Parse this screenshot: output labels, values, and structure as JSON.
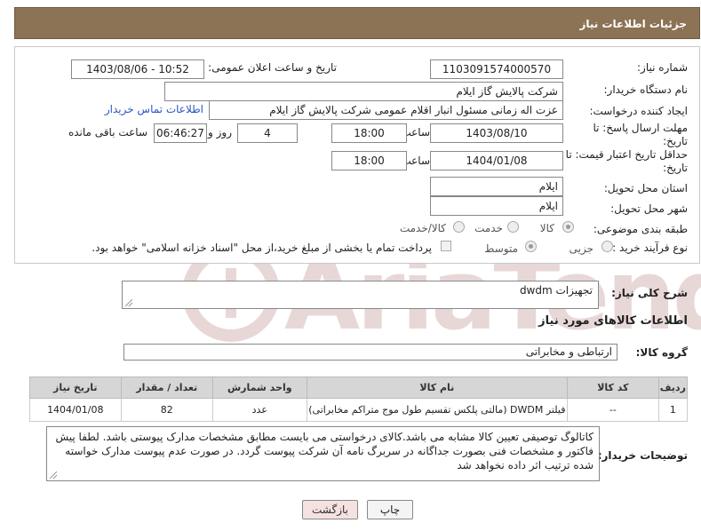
{
  "header": {
    "title": "جزئیات اطلاعات نیاز"
  },
  "form": {
    "need_number_label": "شماره نیاز:",
    "need_number": "1103091574000570",
    "announce_label": "تاریخ و ساعت اعلان عمومی:",
    "announce_value": "1403/08/06 - 10:52",
    "buyer_org_label": "نام دستگاه خریدار:",
    "buyer_org": "شرکت پالایش گاز ایلام",
    "creator_label": "ایجاد کننده درخواست:",
    "creator": "عزت اله زمانی مسئول انبار اقلام عمومی شرکت پالایش گاز ایلام",
    "contact_link": "اطلاعات تماس خریدار",
    "deadline_label_1": "مهلت ارسال پاسخ: تا",
    "deadline_label_2": "تاریخ:",
    "deadline_date": "1403/08/10",
    "time_label": "ساعت",
    "deadline_time": "18:00",
    "days_value": "4",
    "days_label": "روز و",
    "remaining_value": "06:46:27",
    "remaining_label": "ساعت باقی مانده",
    "validity_label_1": "حداقل تاریخ اعتبار قیمت: تا",
    "validity_label_2": "تاریخ:",
    "validity_date": "1404/01/08",
    "validity_time": "18:00",
    "province_label": "استان محل تحویل:",
    "province": "ایلام",
    "city_label": "شهر محل تحویل:",
    "city": "ایلام",
    "category_label": "طبقه بندی موضوعی:",
    "category_options": [
      "کالا",
      "خدمت",
      "کالا/خدمت"
    ],
    "process_label": "نوع فرآیند خرید :",
    "process_options": [
      "جزیی",
      "متوسط"
    ],
    "payment_text": "پرداخت تمام یا بخشی از مبلغ خرید،از محل \"اسناد خزانه اسلامی\" خواهد بود."
  },
  "description": {
    "label": "شرح کلی نیاز:",
    "value": "تجهیزات dwdm"
  },
  "goods": {
    "section_title": "اطلاعات کالاهای مورد نیاز",
    "group_label": "گروه کالا:",
    "group_value": "ارتباطی و مخابراتی",
    "columns": [
      "ردیف",
      "کد کالا",
      "نام کالا",
      "واحد شمارش",
      "تعداد / مقدار",
      "تاریخ نیاز"
    ],
    "rows": [
      [
        "1",
        "--",
        "فیلتر DWDM (مالتی پلکس تقسیم طول موج متراکم مخابراتی)",
        "عدد",
        "82",
        "1404/01/08"
      ]
    ]
  },
  "buyer_notes": {
    "label": "توضیحات خریدار:",
    "value": "کاتالوگ توصیفی تعیین کالا مشابه می باشد.کالای درخواستی می بایست مطابق مشخصات مدارک پیوستی باشد. لطفا پیش فاکتور و مشخصات فنی بصورت جداگانه  در سربرگ نامه آن شرکت پیوست گردد. در صورت عدم پیوست مدارک خواسته شده ترتیب اثر داده نخواهد شد"
  },
  "buttons": {
    "print": "چاپ",
    "back": "بازگشت"
  },
  "colors": {
    "header_bg": "#8c7356",
    "link": "#2a56c6",
    "back_btn_bg": "#f6e1e1"
  }
}
